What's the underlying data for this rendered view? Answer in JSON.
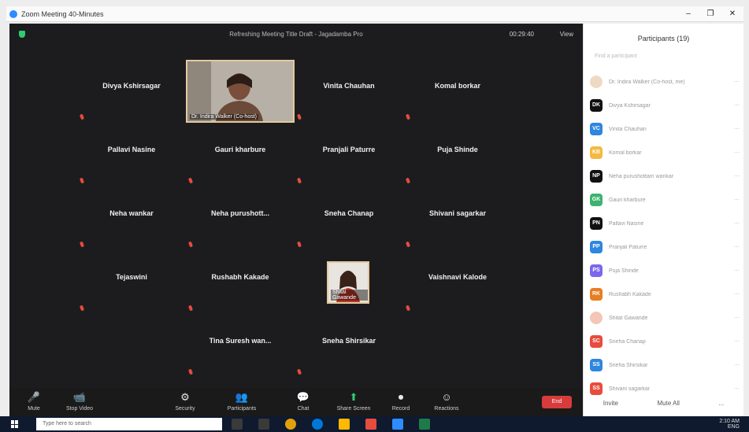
{
  "window": {
    "title": "Zoom Meeting 40-Minutes",
    "controls": [
      "–",
      "❐",
      "✕"
    ]
  },
  "meeting": {
    "title": "Refreshing Meeting Title Draft - Jagadamba Pro",
    "timer": "00:29:40",
    "view": "View"
  },
  "tiles": [
    {
      "name": "Divya Kshirsagar"
    },
    {
      "name": "Vinita Chauhan"
    },
    {
      "name": "Komal borkar"
    },
    {
      "name": "Pallavi Nasine"
    },
    {
      "name": "Gauri kharbure"
    },
    {
      "name": "Pranjali Paturre"
    },
    {
      "name": "Puja Shinde"
    },
    {
      "name": "Neha wankar"
    },
    {
      "name": "Neha purushott..."
    },
    {
      "name": "Sneha Chanap"
    },
    {
      "name": "Shivani sagarkar"
    },
    {
      "name": "Tejaswini"
    },
    {
      "name": "Rushabh Kakade"
    },
    {
      "name": "Vaishnavi Kalode"
    },
    {
      "name": "Tina Suresh wan..."
    },
    {
      "name": "Sneha Shirsikar"
    }
  ],
  "video_tiles": {
    "host_caption": "Dr. Indira Walker (Co-host)",
    "second_caption": "Shital Gawande"
  },
  "toolbar": [
    {
      "icon": "🎤",
      "label": "Mute"
    },
    {
      "icon": "📹",
      "label": "Stop Video"
    },
    {
      "icon": "⚙",
      "label": "Security"
    },
    {
      "icon": "👥",
      "label": "Participants"
    },
    {
      "icon": "💬",
      "label": "Chat"
    },
    {
      "icon": "⬆",
      "label": "Share Screen"
    },
    {
      "icon": "⏺",
      "label": "Record"
    },
    {
      "icon": "☺",
      "label": "Reactions"
    }
  ],
  "end_button": "End",
  "panel": {
    "title": "Participants (19)",
    "search_placeholder": "Find a participant",
    "participants": [
      {
        "initials": "",
        "name": "Dr. Indira Walker (Co-host, me)",
        "color": "#f0d9c4"
      },
      {
        "initials": "DK",
        "name": "Divya Kshirsagar",
        "color": "#111111"
      },
      {
        "initials": "VC",
        "name": "Vinita Chauhan",
        "color": "#2e86de"
      },
      {
        "initials": "KB",
        "name": "Komal borkar",
        "color": "#f5b942"
      },
      {
        "initials": "NP",
        "name": "Neha purushottam wankar",
        "color": "#111111"
      },
      {
        "initials": "GK",
        "name": "Gauri kharbure",
        "color": "#3cb371"
      },
      {
        "initials": "PN",
        "name": "Pallavi Nasine",
        "color": "#111111"
      },
      {
        "initials": "PP",
        "name": "Pranjali Paturre",
        "color": "#2e86de"
      },
      {
        "initials": "PS",
        "name": "Puja Shinde",
        "color": "#7b68ee"
      },
      {
        "initials": "RK",
        "name": "Rushabh Kakade",
        "color": "#e67e22"
      },
      {
        "initials": "",
        "name": "Shital Gawande",
        "color": "#f3c6b8"
      },
      {
        "initials": "SC",
        "name": "Sneha Chanap",
        "color": "#e74c3c"
      },
      {
        "initials": "SS",
        "name": "Sneha Shirsikar",
        "color": "#2e86de"
      },
      {
        "initials": "SS",
        "name": "Shivani sagarkar",
        "color": "#e74c3c"
      }
    ],
    "footer": [
      "Invite",
      "Mute All",
      "..."
    ]
  },
  "taskbar": {
    "search_text": "Type here to search",
    "apps": [
      "#3a3a3a",
      "#3a3a3a",
      "#e0a10b",
      "#0078d7",
      "#ffb900",
      "#e74c3c",
      "#2d8cff",
      "#1f7a4a"
    ],
    "time": "2:10 AM",
    "date": "ENG"
  }
}
